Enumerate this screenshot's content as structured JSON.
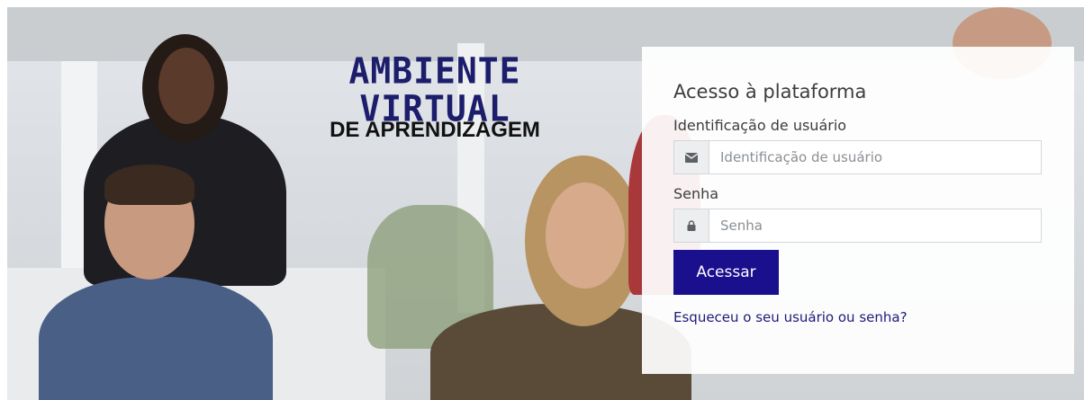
{
  "brand": {
    "line1": "AMBIENTE VIRTUAL",
    "line2": "DE APRENDIZAGEM"
  },
  "login": {
    "title": "Acesso à plataforma",
    "username_label": "Identificação de usuário",
    "username_placeholder": "Identificação de usuário",
    "username_value": "",
    "password_label": "Senha",
    "password_placeholder": "Senha",
    "password_value": "",
    "submit_label": "Acessar",
    "forgot_link": "Esqueceu o seu usuário ou senha?",
    "username_icon": "envelope-icon",
    "password_icon": "lock-icon"
  },
  "colors": {
    "brand_navy": "#1c1d6b",
    "button_bg": "#1a0f8c",
    "link": "#1e1a7a"
  }
}
